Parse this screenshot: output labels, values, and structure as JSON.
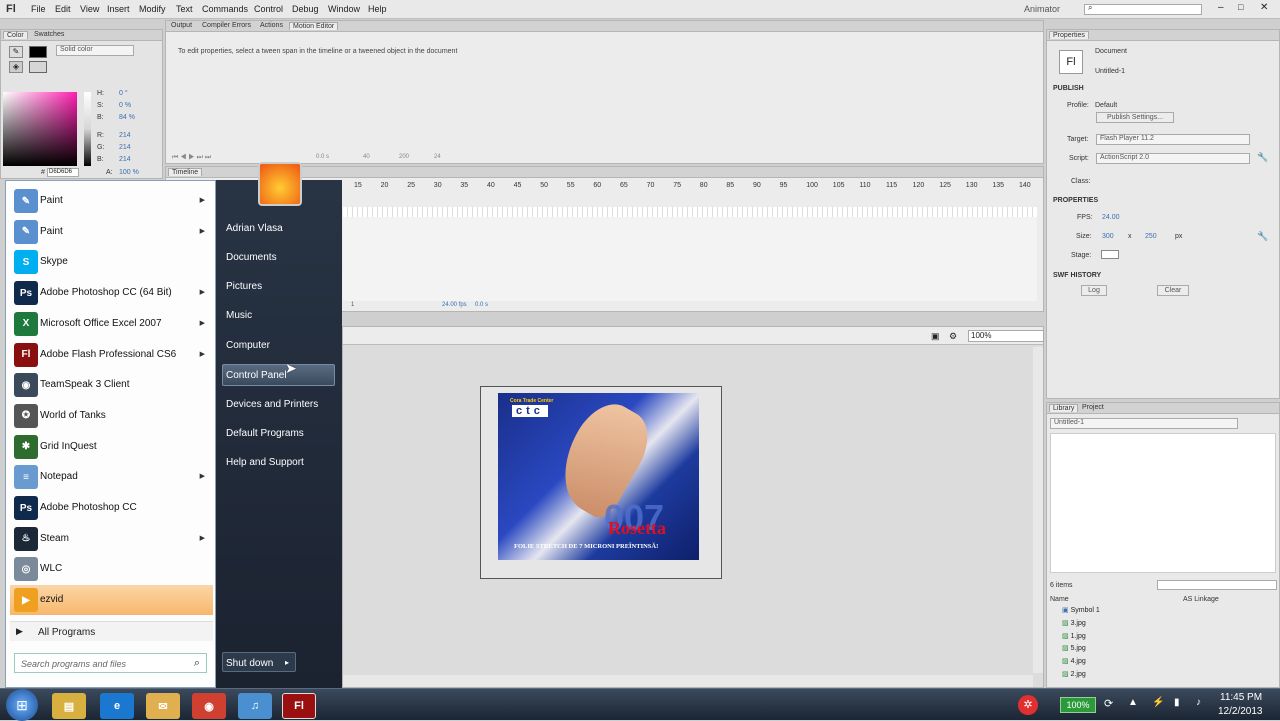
{
  "menubar": {
    "logo": "Fl",
    "items": [
      "File",
      "Edit",
      "View",
      "Insert",
      "Modify",
      "Text",
      "Commands",
      "Control",
      "Debug",
      "Window",
      "Help"
    ],
    "workspace": "Animator"
  },
  "color_panel": {
    "tabs": [
      "Color",
      "Swatches"
    ],
    "mode": "Solid color",
    "h_label": "H:",
    "h_val": "0 °",
    "s_label": "S:",
    "s_val": "0 %",
    "b_label": "B:",
    "b_val": "84 %",
    "r_label": "R:",
    "r_val": "214",
    "g_label": "G:",
    "g_val": "214",
    "bl_label": "B:",
    "bl_val": "214",
    "hex_label": "#",
    "hex_val": "D6D6D6",
    "a_label": "A:",
    "a_val": "100 %"
  },
  "output_panel": {
    "tabs": [
      "Output",
      "Compiler Errors",
      "Actions",
      "Motion Editor"
    ],
    "message": "To edit properties, select a tween span in the timeline or a tweened object in the document",
    "zoom": "0.0 s",
    "v1": "40",
    "v2": "200",
    "v3": "24"
  },
  "timeline": {
    "tab": "Timeline",
    "ruler": [
      "15",
      "20",
      "25",
      "30",
      "35",
      "40",
      "45",
      "50",
      "55",
      "60",
      "65",
      "70",
      "75",
      "80",
      "85",
      "90",
      "95",
      "100",
      "105",
      "110",
      "115",
      "120",
      "125",
      "130",
      "135",
      "140"
    ],
    "frame": "1",
    "fps": "24.00 fps",
    "time": "0.0 s"
  },
  "stage": {
    "zoom": "100%",
    "banner_top": "Cora Trade Center",
    "banner_logo": "ctc",
    "banner_number": "007",
    "banner_brand": "Rosetta",
    "banner_caption": "FOLIE STRETCH DE 7 MICRONI PREÎNTINSĂ!"
  },
  "properties": {
    "tab": "Properties",
    "doc_icon": "Fl",
    "doc_type": "Document",
    "doc_name": "Untitled-1",
    "publish_head": "PUBLISH",
    "profile_label": "Profile:",
    "profile_val": "Default",
    "publish_btn": "Publish Settings...",
    "target_label": "Target:",
    "target_val": "Flash Player 11.2",
    "script_label": "Script:",
    "script_val": "ActionScript 2.0",
    "class_label": "Class:",
    "props_head": "PROPERTIES",
    "fps_label": "FPS:",
    "fps_val": "24.00",
    "size_label": "Size:",
    "size_w": "300",
    "size_x": "x",
    "size_h": "250",
    "size_unit": "px",
    "stage_label": "Stage:",
    "swf_head": "SWF HISTORY",
    "log_btn": "Log",
    "clear_btn": "Clear"
  },
  "library": {
    "tabs": [
      "Library",
      "Project"
    ],
    "doc": "Untitled-1",
    "count": "6 items",
    "col_name": "Name",
    "col_link": "AS Linkage",
    "items": [
      "Symbol 1",
      "3.jpg",
      "1.jpg",
      "5.jpg",
      "4.jpg",
      "2.jpg"
    ]
  },
  "start_menu": {
    "programs": [
      {
        "label": "Paint",
        "icon": "paint-icon",
        "color": "#5a8fd0",
        "glyph": "✎",
        "arrow": true
      },
      {
        "label": "Paint",
        "icon": "paint-icon",
        "color": "#5a8fd0",
        "glyph": "✎",
        "arrow": true
      },
      {
        "label": "Skype",
        "icon": "skype-icon",
        "color": "#00aff0",
        "glyph": "S",
        "arrow": false
      },
      {
        "label": "Adobe Photoshop CC (64 Bit)",
        "icon": "photoshop-icon",
        "color": "#102a4c",
        "glyph": "Ps",
        "arrow": true
      },
      {
        "label": "Microsoft Office Excel 2007",
        "icon": "excel-icon",
        "color": "#1e7a3c",
        "glyph": "X",
        "arrow": true
      },
      {
        "label": "Adobe Flash Professional CS6",
        "icon": "flash-icon",
        "color": "#8a1010",
        "glyph": "Fl",
        "arrow": true
      },
      {
        "label": "TeamSpeak 3 Client",
        "icon": "teamspeak-icon",
        "color": "#3a4a5a",
        "glyph": "◉",
        "arrow": false
      },
      {
        "label": "World of Tanks",
        "icon": "tanks-icon",
        "color": "#555",
        "glyph": "✪",
        "arrow": false
      },
      {
        "label": "Grid InQuest",
        "icon": "grid-icon",
        "color": "#2e6b2e",
        "glyph": "✱",
        "arrow": false
      },
      {
        "label": "Notepad",
        "icon": "notepad-icon",
        "color": "#6a9bd0",
        "glyph": "≡",
        "arrow": true
      },
      {
        "label": "Adobe Photoshop CC",
        "icon": "photoshop-icon",
        "color": "#102a4c",
        "glyph": "Ps",
        "arrow": false
      },
      {
        "label": "Steam",
        "icon": "steam-icon",
        "color": "#1b2838",
        "glyph": "♨",
        "arrow": true
      },
      {
        "label": "WLC",
        "icon": "wlc-icon",
        "color": "#7a8a9a",
        "glyph": "◎",
        "arrow": false
      },
      {
        "label": "ezvid",
        "icon": "ezvid-icon",
        "color": "#f0a020",
        "glyph": "▶",
        "arrow": false
      }
    ],
    "all_programs": "All Programs",
    "search_placeholder": "Search programs and files",
    "right_items": [
      "Adrian Vlasa",
      "Documents",
      "Pictures",
      "Music",
      "Computer",
      "Control Panel",
      "Devices and Printers",
      "Default Programs",
      "Help and Support"
    ],
    "shutdown": "Shut down"
  },
  "taskbar": {
    "battery": "100%",
    "time": "11:45 PM",
    "date": "12/2/2013"
  }
}
